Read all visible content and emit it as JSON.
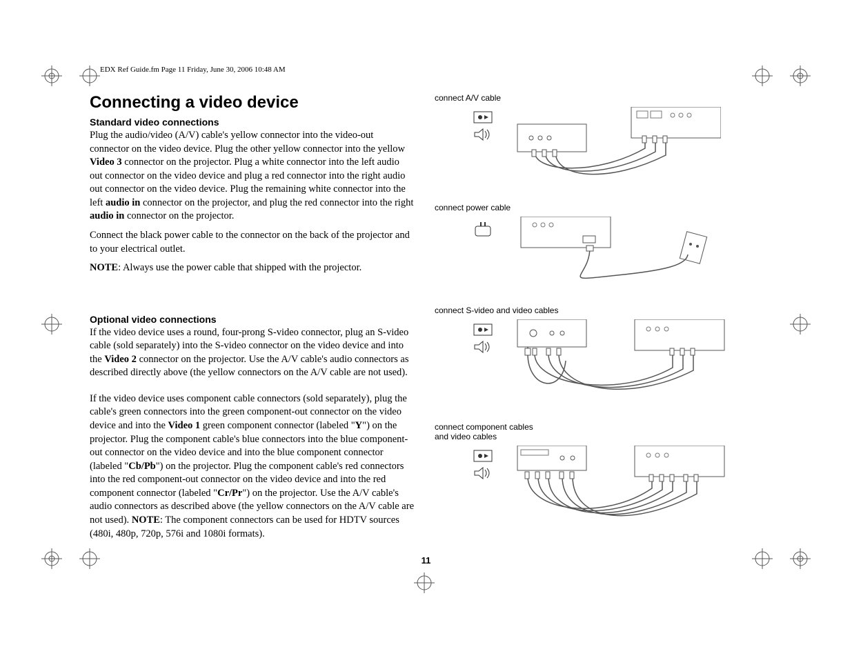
{
  "header": "EDX Ref Guide.fm  Page 11  Friday, June 30, 2006  10:48 AM",
  "title": "Connecting a video device",
  "sec1_title": "Standard video connections",
  "sec1_p1a": "Plug the audio/video (A/V) cable's yellow connector into the video-out connector on the video device. Plug the other yellow connector into the yellow ",
  "sec1_p1b": "Video 3",
  "sec1_p1c": " connector on the projector. Plug a white connector into the left audio out connector on the video device and plug a red connector into the right audio out connector on the video device. Plug the remaining white connector into the left ",
  "sec1_p1d": "audio in",
  "sec1_p1e": " connector on the projector, and plug the red connector into the right ",
  "sec1_p1f": "audio in",
  "sec1_p1g": " connector on the projector.",
  "sec1_p2": "Connect the black power cable to the connector on the back of the projector and to your electrical outlet.",
  "sec1_note_label": "NOTE",
  "sec1_note_text": ": Always use the power cable that shipped with the projector.",
  "sec2_title": "Optional video connections",
  "sec2_p1a": "If the video device uses a round, four-prong S-video connector, plug an S-video cable (sold separately) into the S-video connector on the video device and into the ",
  "sec2_p1b": "Video 2",
  "sec2_p1c": " connector on the projector. Use the A/V cable's audio connectors as described directly above (the yellow connectors on the A/V cable are not used).",
  "sec2_p2a": "If the video device uses component cable connectors (sold separately), plug the cable's green connectors into the green component-out connector on the video device and into the ",
  "sec2_p2b": "Video 1",
  "sec2_p2c": " green component connector (labeled \"",
  "sec2_p2d": "Y",
  "sec2_p2e": "\") on the projector. Plug the component cable's blue connectors into the blue component-out connector on the video device and into the blue component connector (labeled \"",
  "sec2_p2f": "Cb/Pb",
  "sec2_p2g": "\") on the projector. Plug the component cable's red connectors into the red component-out connector on the video device and into the red component connector (labeled \"",
  "sec2_p2h": "Cr/Pr",
  "sec2_p2i": "\") on the projector. Use the A/V cable's audio connectors as described above (the yellow connectors on the A/V cable are not used). ",
  "sec2_p2j": "NOTE",
  "sec2_p2k": ": The component connectors can be used for HDTV sources (480i, 480p, 720p, 576i and 1080i formats).",
  "fig1_label": "connect A/V cable",
  "fig2_label": "connect power cable",
  "fig3_label": "connect S-video and video cables",
  "fig4_label1": "connect component cables",
  "fig4_label2": "and video cables",
  "page_number": "11"
}
